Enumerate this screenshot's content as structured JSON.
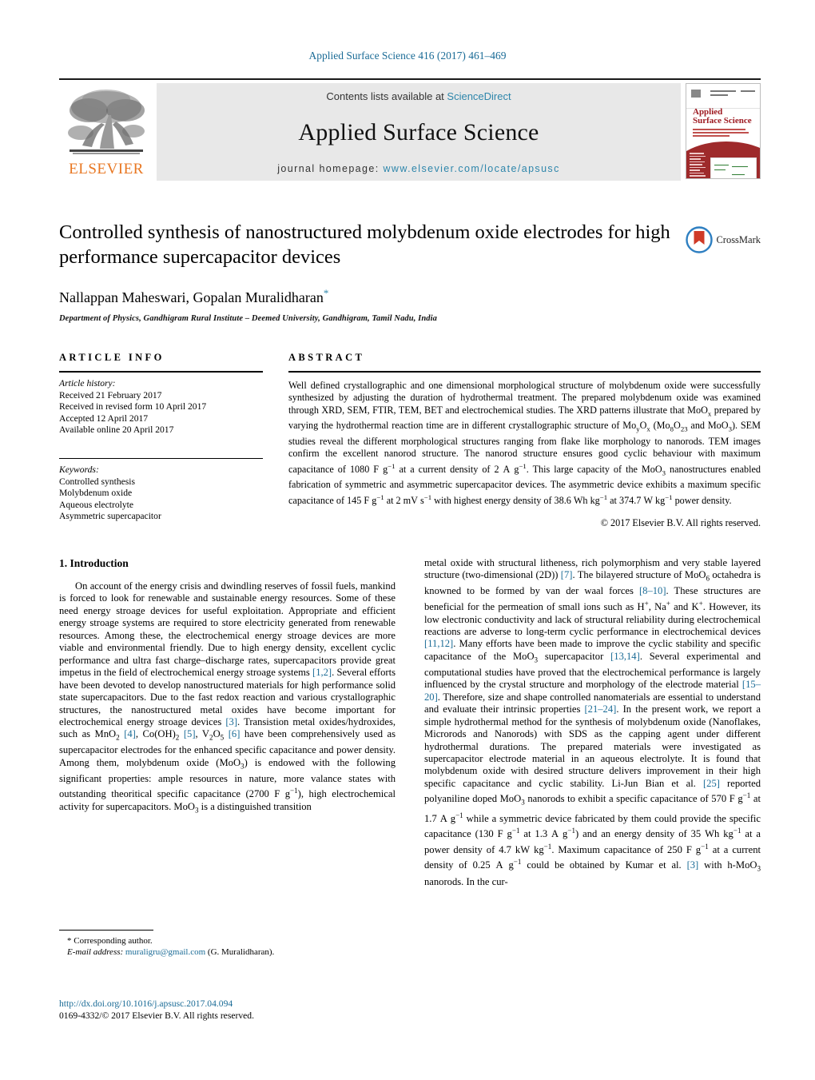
{
  "running_head": "Applied Surface Science 416 (2017) 461–469",
  "masthead": {
    "publisher_name": "ELSEVIER",
    "contents_prefix": "Contents lists available at ",
    "contents_link": "ScienceDirect",
    "journal_title": "Applied Surface Science",
    "homepage_prefix": "journal homepage: ",
    "homepage_url": "www.elsevier.com/locate/apsusc",
    "cover": {
      "journal_line1": "Applied",
      "journal_line2": "Surface Science"
    },
    "link_color": "#2e86ab",
    "banner_bg": "#e8e8e8",
    "elsevier_orange": "#E87722"
  },
  "article": {
    "title": "Controlled synthesis of nanostructured molybdenum oxide electrodes for high performance supercapacitor devices",
    "authors": "Nallappan Maheswari, Gopalan Muralidharan",
    "corresponding_marker": "*",
    "affiliation": "Department of Physics, Gandhigram Rural Institute – Deemed University, Gandhigram, Tamil Nadu, India",
    "crossmark_label": "CrossMark"
  },
  "article_info": {
    "heading": "ARTICLE INFO",
    "history_label": "Article history:",
    "history": [
      "Received 21 February 2017",
      "Received in revised form 10 April 2017",
      "Accepted 12 April 2017",
      "Available online 20 April 2017"
    ],
    "keywords_label": "Keywords:",
    "keywords": [
      "Controlled synthesis",
      "Molybdenum oxide",
      "Aqueous electrolyte",
      "Asymmetric supercapacitor"
    ]
  },
  "abstract": {
    "heading": "ABSTRACT",
    "copyright": "© 2017 Elsevier B.V. All rights reserved."
  },
  "introduction": {
    "heading": "1.  Introduction"
  },
  "footnote": {
    "corresponding": "* Corresponding author.",
    "email_label": "E-mail address:",
    "email": "muraligru@gmail.com",
    "email_owner": "(G. Muralidharan)."
  },
  "doi": {
    "url": "http://dx.doi.org/10.1016/j.apsusc.2017.04.094",
    "issn_line": "0169-4332/© 2017 Elsevier B.V. All rights reserved."
  }
}
